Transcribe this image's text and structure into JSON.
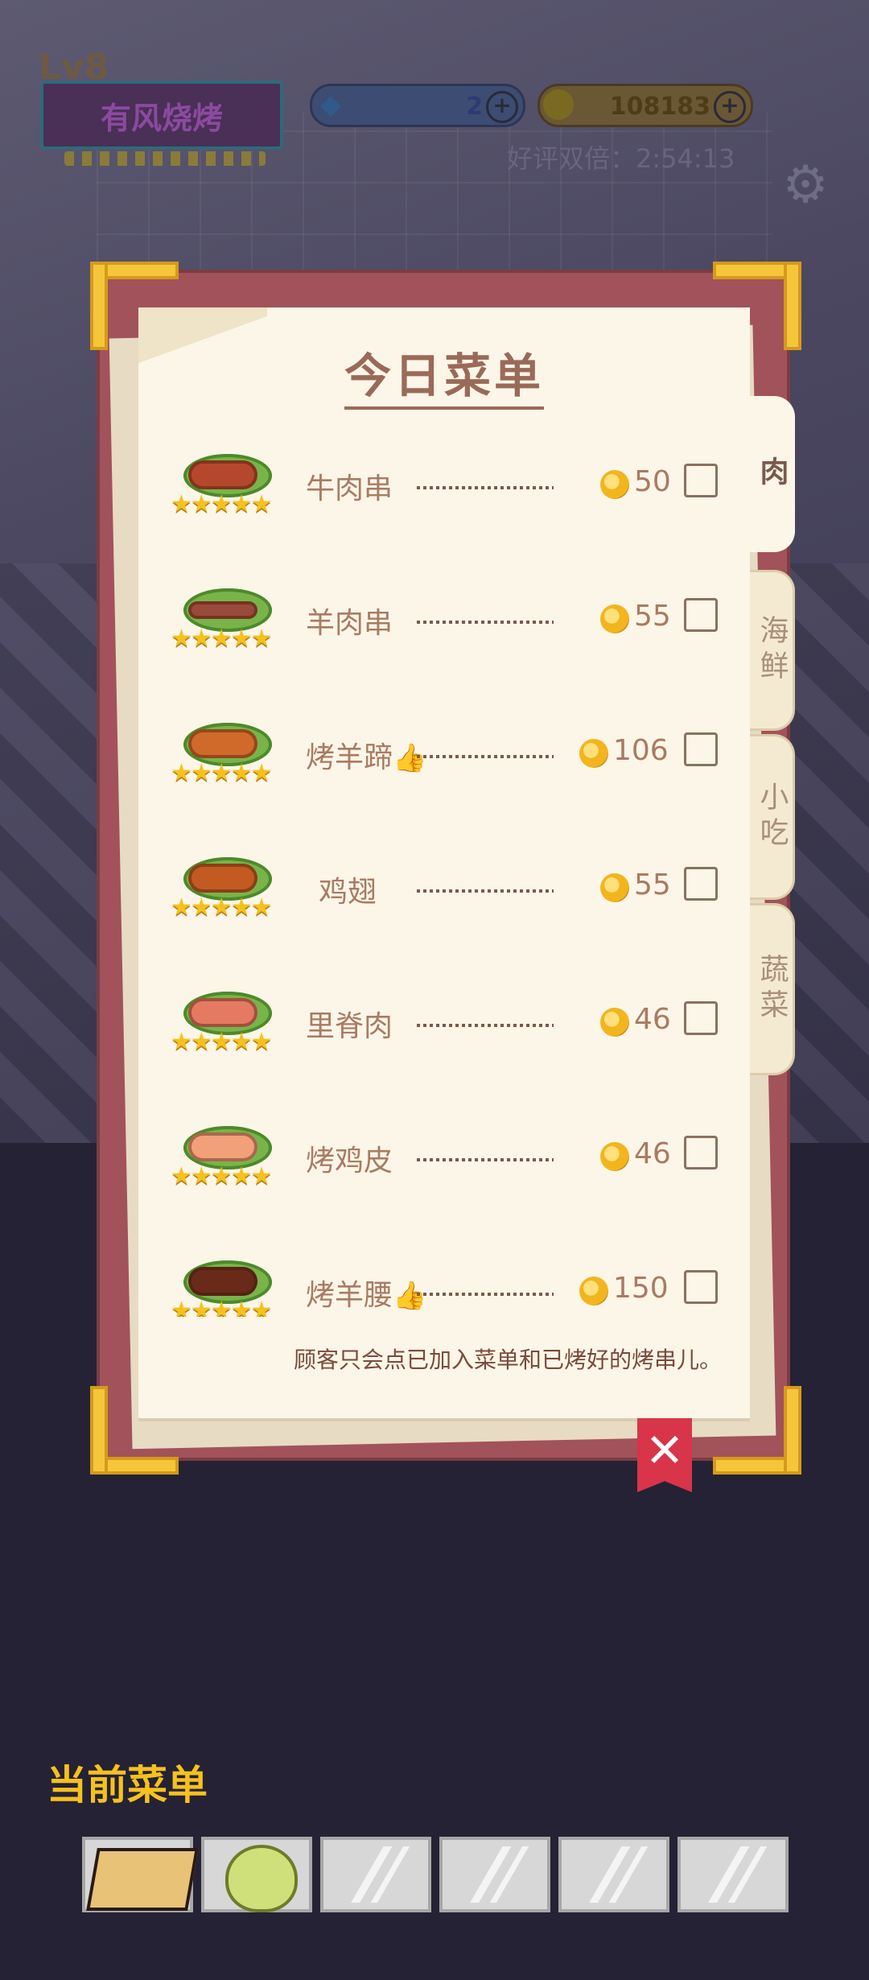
{
  "hud": {
    "level": "Lv8",
    "shop_name": "有风烧烤",
    "gems": "2",
    "coins": "108183",
    "double_review": "好评双倍：2:54:13"
  },
  "menu": {
    "title": "今日菜单",
    "tabs": [
      "肉",
      "海鲜",
      "小吃",
      "蔬菜"
    ],
    "active_tab": "肉",
    "items": [
      {
        "name": "牛肉串",
        "price": "50",
        "recommended": false,
        "color": "#b5482c"
      },
      {
        "name": "羊肉串",
        "price": "55",
        "recommended": false,
        "color": "#9a4a3a"
      },
      {
        "name": "烤羊蹄",
        "price": "106",
        "recommended": true,
        "color": "#d06a2a"
      },
      {
        "name": "鸡翅",
        "price": "55",
        "recommended": false,
        "color": "#c25a22"
      },
      {
        "name": "里脊肉",
        "price": "46",
        "recommended": false,
        "color": "#e57a62"
      },
      {
        "name": "烤鸡皮",
        "price": "46",
        "recommended": false,
        "color": "#f2a07a"
      },
      {
        "name": "烤羊腰",
        "price": "150",
        "recommended": true,
        "color": "#6a2a1a"
      }
    ],
    "note": "顾客只会点已加入菜单和已烤好的烤串儿。",
    "close_icon": "✕"
  },
  "current_menu": {
    "title": "当前菜单"
  },
  "icons": {
    "thumb": "👍",
    "gear": "⚙",
    "gem": "◆",
    "star": "★★★★★"
  }
}
